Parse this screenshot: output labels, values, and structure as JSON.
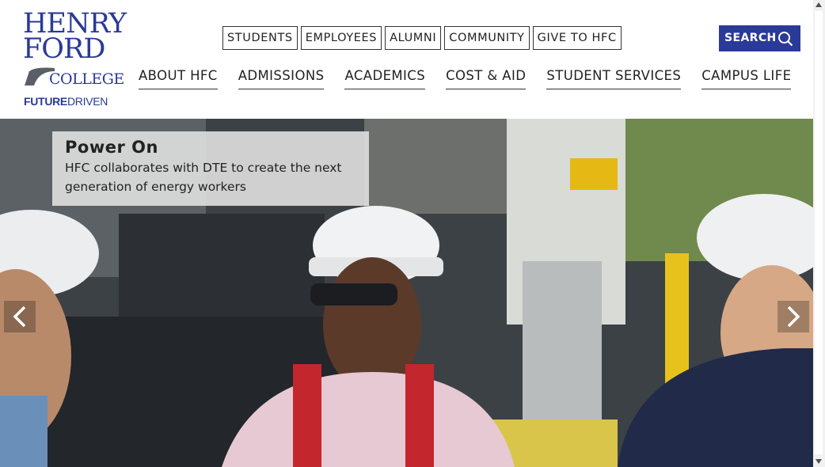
{
  "logo": {
    "line1": "HENRY",
    "line2": "FORD",
    "line3": "COLLEGE",
    "tagline_a": "FUTURE",
    "tagline_b": "DRIVEN"
  },
  "utility_nav": [
    "STUDENTS",
    "EMPLOYEES",
    "ALUMNI",
    "COMMUNITY",
    "GIVE TO HFC"
  ],
  "search": {
    "label": "SEARCH",
    "icon": "search-icon"
  },
  "main_nav": [
    "ABOUT HFC",
    "ADMISSIONS",
    "ACADEMICS",
    "COST & AID",
    "STUDENT SERVICES",
    "CAMPUS LIFE"
  ],
  "hero": {
    "title": "Power On",
    "text": "HFC collaborates with DTE to create the next generation of energy workers",
    "prev_icon": "chevron-left-icon",
    "next_icon": "chevron-right-icon"
  },
  "colors": {
    "brand": "#2a3a98",
    "text": "#222222"
  }
}
